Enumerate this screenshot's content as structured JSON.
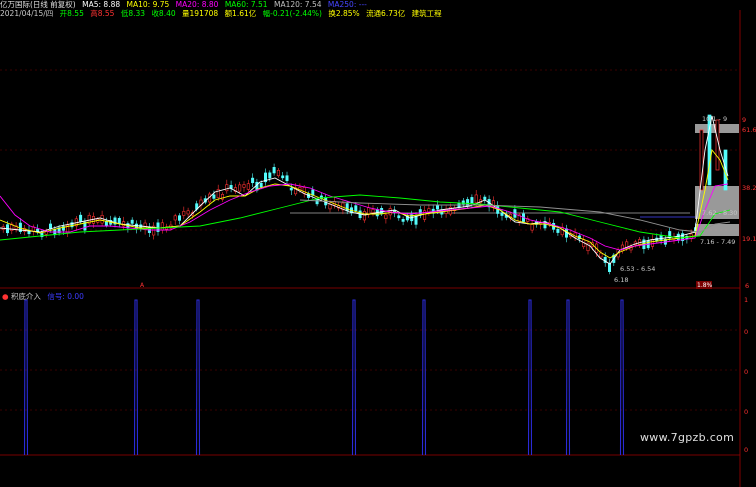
{
  "header": {
    "stock_name": "亿万国际(日线 前复权)",
    "ma5": "MA5: 8.88",
    "ma10": "MA10: 9.75",
    "ma20": "MA20: 8.80",
    "ma60": "MA60: 7.51",
    "ma120": "MA120: 7.54",
    "ma250": "MA250: ---",
    "date": "2021/04/15/四",
    "open": "开8.55",
    "high": "高8.55",
    "low": "低8.33",
    "close": "收8.40",
    "volume": "量191708",
    "amount": "额1.61亿",
    "change": "幅-0.21(-2.44%)",
    "turnover": "换2.85%",
    "float_cap": "流通6.73亿",
    "industry": "建筑工程"
  },
  "right_axis": {
    "labels": [
      "9",
      "61.6",
      "38.2",
      "19.1",
      "6"
    ]
  },
  "annotations": {
    "high_range": "10.1 - 9",
    "range_1": "7.62 - 8.30",
    "range_2": "7.16 - 7.49",
    "range_3": "6.53 - 6.54",
    "low_point": "6.18",
    "marker_a": "A",
    "marker_b": "1.8%"
  },
  "indicator": {
    "title": "积底介入",
    "subtitle": "信号: 0.00",
    "axis_labels": [
      "1",
      "0",
      "0",
      "0",
      "0"
    ]
  },
  "chart_data": {
    "type": "line",
    "title": "",
    "x_label": "",
    "y_label": "",
    "series": [
      {
        "name": "MA5",
        "color": "#ffffff"
      },
      {
        "name": "MA10",
        "color": "#ffff00"
      },
      {
        "name": "MA20",
        "color": "#ff00ff"
      },
      {
        "name": "MA60",
        "color": "#00ff00"
      },
      {
        "name": "MA120",
        "color": "#808080"
      }
    ],
    "indicator_signals": [
      {
        "x_index": 3,
        "value": 1
      },
      {
        "x_index": 18,
        "value": 1
      },
      {
        "x_index": 25,
        "value": 1
      },
      {
        "x_index": 58,
        "value": 1
      },
      {
        "x_index": 70,
        "value": 1
      },
      {
        "x_index": 87,
        "value": 1
      },
      {
        "x_index": 94,
        "value": 1
      },
      {
        "x_index": 103,
        "value": 1
      }
    ]
  },
  "watermark": "www.7gpzb.com",
  "colors": {
    "up": "#ff3232",
    "down": "#54fcfc",
    "signal": "#2b2bd6",
    "grid": "#7a0000"
  }
}
